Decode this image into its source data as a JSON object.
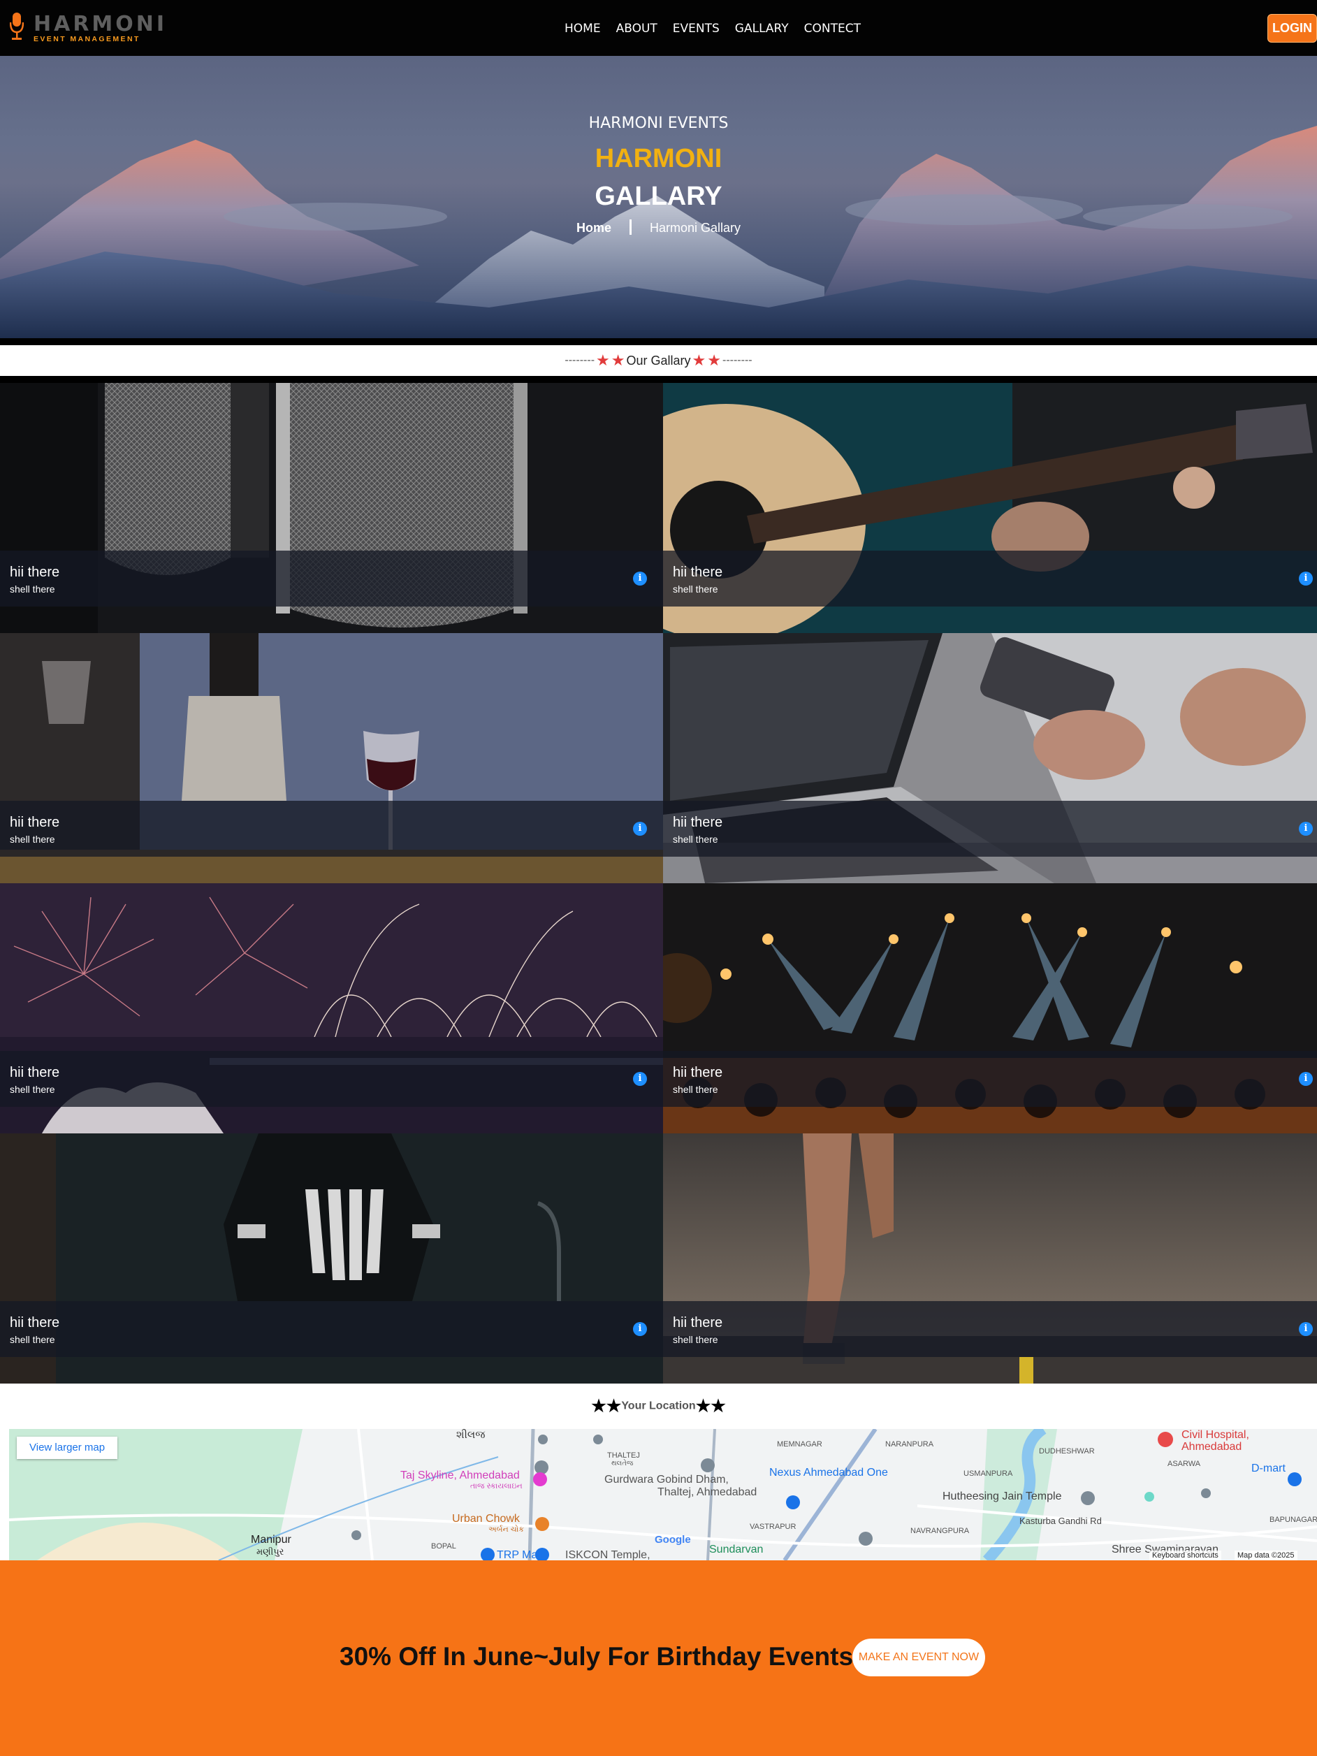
{
  "navbar": {
    "logo_title": "HARMONI",
    "logo_subtitle": "EVENT MANAGEMENT",
    "links": [
      "HOME",
      "ABOUT",
      "EVENTS",
      "GALLARY",
      "CONTECT"
    ],
    "login_label": "LOGIN"
  },
  "hero": {
    "eyebrow": "HARMONI EVENTS",
    "title": "HARMONI",
    "subtitle": "GALLARY",
    "breadcrumb_home": "Home",
    "breadcrumb_current": "Harmoni Gallary"
  },
  "gallery": {
    "dashes_left": "--------",
    "heading": "Our Gallary",
    "dashes_right": "--------",
    "tiles": [
      {
        "title": "hii there",
        "subtitle": "shell there",
        "image": "microphones"
      },
      {
        "title": "hii there",
        "subtitle": "shell there",
        "image": "acoustic-guitar"
      },
      {
        "title": "hii there",
        "subtitle": "shell there",
        "image": "wine-pouring"
      },
      {
        "title": "hii there",
        "subtitle": "shell there",
        "image": "laptop-camera"
      },
      {
        "title": "hii there",
        "subtitle": "shell there",
        "image": "fireworks"
      },
      {
        "title": "hii there",
        "subtitle": "shell there",
        "image": "concert-lights"
      },
      {
        "title": "hii there",
        "subtitle": "shell there",
        "image": "man-dark-shirt"
      },
      {
        "title": "hii there",
        "subtitle": "shell there",
        "image": "runner-road"
      }
    ]
  },
  "location": {
    "heading": "Your Location",
    "map_button": "View larger map",
    "labels": {
      "shilaj": "શીલજ",
      "taj": "Taj Skyline, Ahmedabad",
      "taj_guj": "તાજ સ્કાયલાઇન",
      "thaltej": "THALTEJ",
      "thaltej_guj": "થલતેજ",
      "gurdwara": "Gurdwara Gobind Dham,",
      "gurdwara2": "Thaltej, Ahmedabad",
      "urban": "Urban Chowk",
      "urban_guj": "અર્બન ચોક",
      "manipur": "Manipur",
      "manipur_guj": "મણીપુર",
      "bopal": "BOPAL",
      "trp": "TRP Mall",
      "iskcon": "ISKCON Temple,",
      "sundarvan": "Sundarvan",
      "vastrapur": "VASTRAPUR",
      "memnagar": "MEMNAGAR",
      "naranpura": "NARANPURA",
      "nexus": "Nexus Ahmedabad One",
      "usmanpura": "USMANPURA",
      "hutheesing": "Hutheesing Jain Temple",
      "navrangpura": "NAVRANGPURA",
      "kasturba": "Kasturba Gandhi Rd",
      "shree": "Shree Swaminarayan",
      "dudheshwar": "DUDHESHWAR",
      "asarwa": "ASARWA",
      "civil": "Civil Hospital,",
      "civil2": "Ahmedabad",
      "dmart": "D-mart",
      "bapunagar": "BAPUNAGAR",
      "google": "Google",
      "keyboard": "Keyboard shortcuts",
      "mapdata": "Map data ©2025"
    }
  },
  "promo": {
    "text": "30% Off In June~July For Birthday Events",
    "button": "MAKE AN EVENT NOW"
  },
  "colors": {
    "accent_orange": "#f67316",
    "hero_gold": "#f2b111",
    "info_blue": "#1e8fff",
    "star_red": "#e13b3b"
  }
}
